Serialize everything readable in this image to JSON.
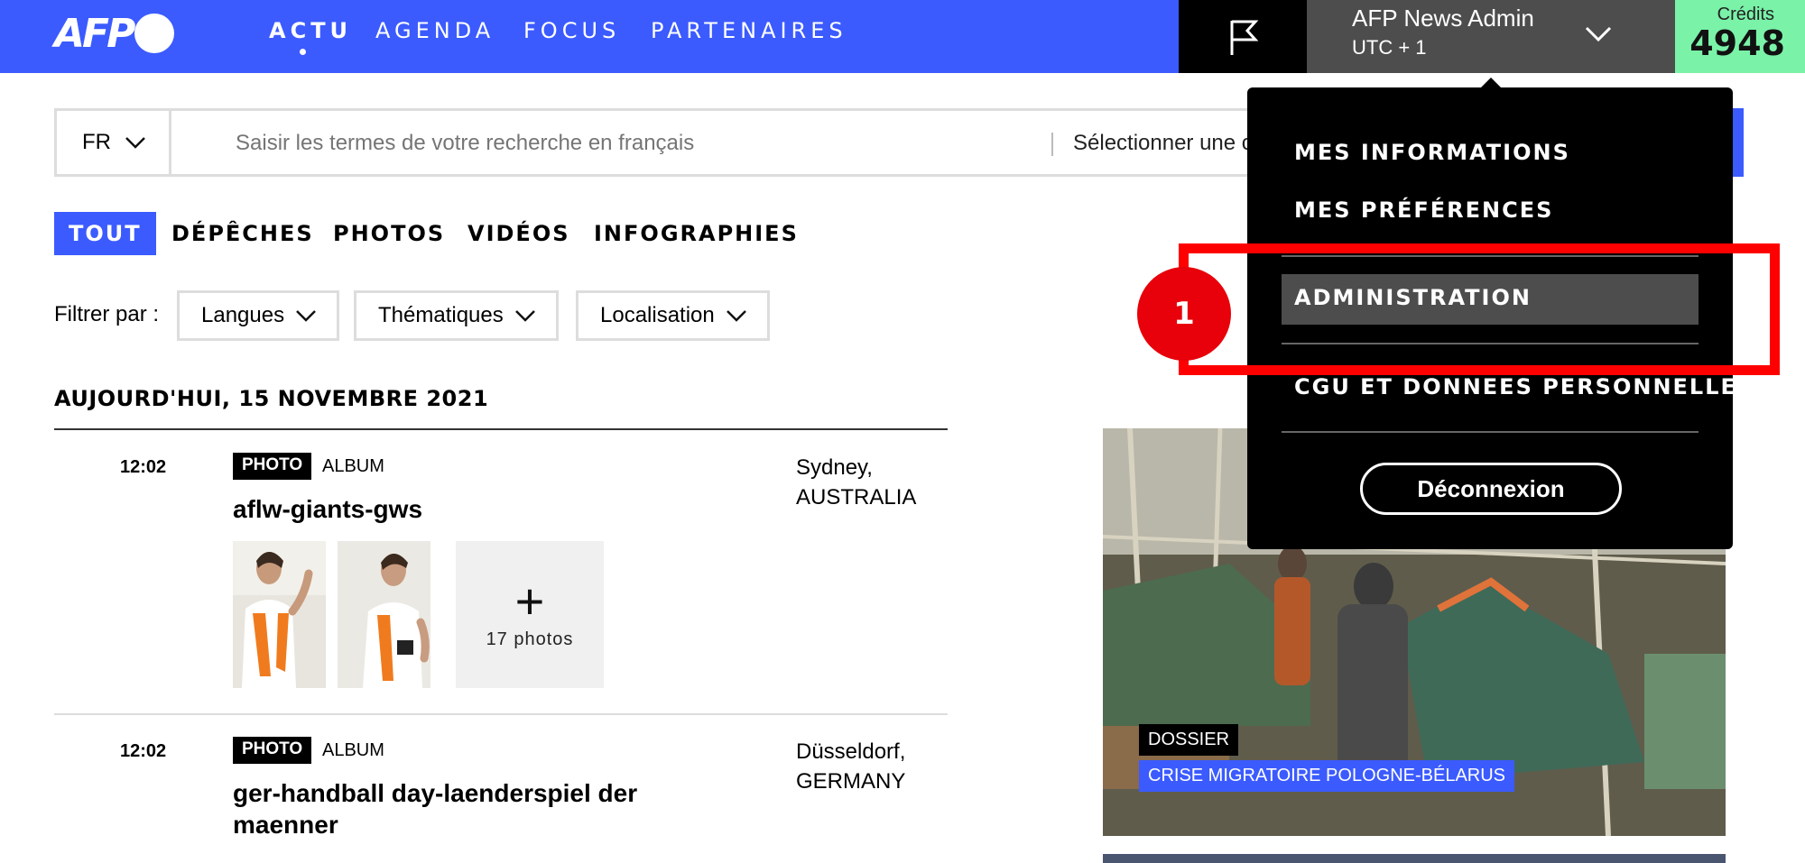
{
  "header": {
    "logo_text": "AFP",
    "nav": [
      {
        "label": "ACTU",
        "active": true
      },
      {
        "label": "AGENDA"
      },
      {
        "label": "FOCUS"
      },
      {
        "label": "PARTENAIRES"
      }
    ],
    "user": {
      "name": "AFP News Admin",
      "timezone": "UTC + 1"
    },
    "credits": {
      "label": "Crédits",
      "value": "4948"
    },
    "colors": {
      "primary": "#3b5bff",
      "credits_bg": "#7af2a8",
      "user_bg": "#4d4d4d"
    }
  },
  "search": {
    "language": "FR",
    "placeholder": "Saisir les termes de votre recherche en français",
    "category_placeholder": "Sélectionner une c"
  },
  "tabs": [
    {
      "label": "TOUT",
      "active": true
    },
    {
      "label": "DÉPÊCHES"
    },
    {
      "label": "PHOTOS"
    },
    {
      "label": "VIDÉOS"
    },
    {
      "label": "INFOGRAPHIES"
    }
  ],
  "filters": {
    "label": "Filtrer par :",
    "buttons": [
      "Langues",
      "Thématiques",
      "Localisation"
    ]
  },
  "feed": {
    "date_heading": "AUJOURD'HUI, 15 NOVEMBRE 2021",
    "items": [
      {
        "time": "12:02",
        "type": "PHOTO",
        "subtype": "ALBUM",
        "title": "aflw-giants-gws",
        "location_city": "Sydney,",
        "location_country": "AUSTRALIA",
        "more_photos": "17  photos"
      },
      {
        "time": "12:02",
        "type": "PHOTO",
        "subtype": "ALBUM",
        "title": "ger-handball day-laenderspiel der maenner",
        "location_city": "Düsseldorf,",
        "location_country": "GERMANY"
      }
    ]
  },
  "feature": {
    "badge": "DOSSIER",
    "topic": "CRISE MIGRATOIRE POLOGNE-BÉLARUS"
  },
  "user_menu": {
    "items": [
      "MES INFORMATIONS",
      "MES PRÉFÉRENCES",
      "ADMINISTRATION",
      "CGU ET DONNEES PERSONNELLES"
    ],
    "highlighted": "ADMINISTRATION",
    "logout": "Déconnexion"
  },
  "annotation": {
    "step": "1",
    "color": "#ff0000"
  }
}
